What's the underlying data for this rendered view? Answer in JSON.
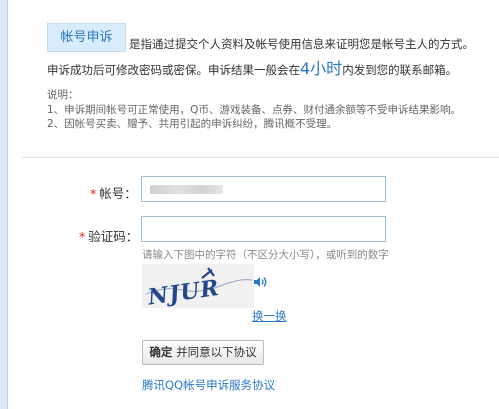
{
  "header": {
    "badge": "帐号申诉",
    "intro_line1": "是指通过提交个人资料及帐号使用信息来证明您是帐号主人的方式。",
    "intro_line2_before": "申诉成功后可修改密码或密保。申诉结果一般会在",
    "intro_line2_highlight": "4小时",
    "intro_line2_after": "内发到您的联系邮箱。"
  },
  "notes": {
    "title": "说明：",
    "items": [
      "1、申诉期间帐号可正常使用，Q币、游戏装备、点券、财付通余额等不受申诉结果影响。",
      "2、因帐号买卖、赠予、共用引起的申诉纠纷，腾讯概不受理。"
    ]
  },
  "form": {
    "required_mark": "*",
    "account_label": "帐号：",
    "account_value": "",
    "captcha_label": "验证码：",
    "captcha_value": "",
    "captcha_hint": "请输入下图中的字符（不区分大小写），或听到的数字",
    "captcha_image_text": "NJUR",
    "refresh_label": "换一换",
    "submit_bold": "确定",
    "submit_rest": "并同意以下协议",
    "agreement_link": "腾讯QQ帐号申诉服务协议"
  },
  "icons": {
    "sound": "speaker-icon"
  },
  "colors": {
    "accent": "#2a78c5",
    "required": "#e02222",
    "badge_bg": "#d8ecfb",
    "input_border": "#9fbed8"
  }
}
